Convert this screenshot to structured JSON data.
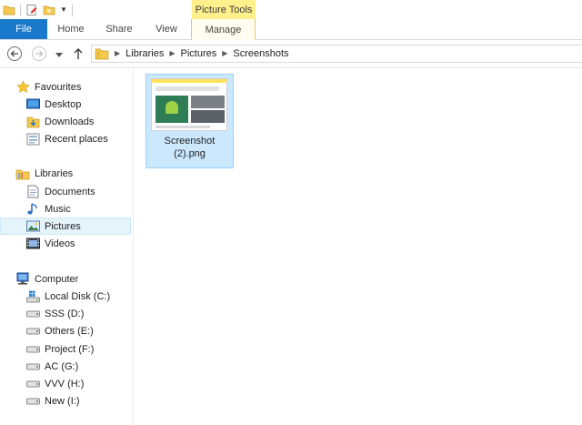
{
  "ribbon": {
    "contextual_group": "Picture Tools",
    "tabs": {
      "file": "File",
      "home": "Home",
      "share": "Share",
      "view": "View",
      "manage": "Manage"
    },
    "file_tab_color": "#1979ca",
    "contextual_color": "#fff08c"
  },
  "address": {
    "breadcrumbs": [
      "Libraries",
      "Pictures",
      "Screenshots"
    ]
  },
  "navpane": {
    "favourites": {
      "label": "Favourites",
      "items": [
        "Desktop",
        "Downloads",
        "Recent places"
      ]
    },
    "libraries": {
      "label": "Libraries",
      "items": [
        "Documents",
        "Music",
        "Pictures",
        "Videos"
      ],
      "selected": "Pictures"
    },
    "computer": {
      "label": "Computer",
      "items": [
        "Local Disk (C:)",
        "SSS (D:)",
        "Others (E:)",
        "Project (F:)",
        "AC (G:)",
        "VVV (H:)",
        "New (I:)"
      ]
    },
    "selection_color": "#e5f3fb"
  },
  "files": [
    {
      "line1": "Screenshot",
      "line2": "(2).png",
      "selected": true
    }
  ]
}
